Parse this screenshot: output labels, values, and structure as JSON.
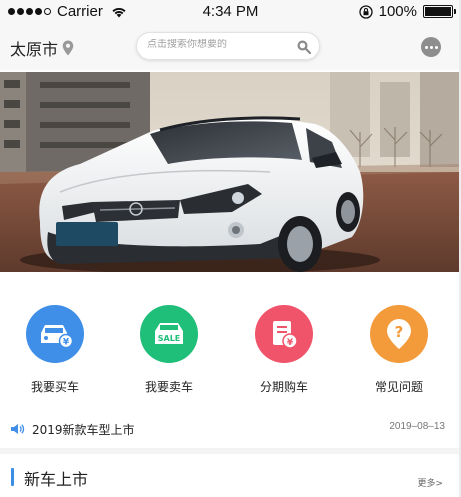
{
  "status_bar": {
    "carrier": "Carrier",
    "time": "4:34 PM",
    "battery_text": "100%",
    "battery_level": 1.0
  },
  "nav": {
    "city": "太原市",
    "search_placeholder": "点击搜索你想要的",
    "icons": [
      "location-icon",
      "search-icon",
      "more-icon"
    ]
  },
  "banner": {
    "icon": "car-photo"
  },
  "quick_menu": [
    {
      "label": "我要买车",
      "color": "#3f8fe8",
      "icon": "buy-car-icon"
    },
    {
      "label": "我要卖车",
      "color": "#1fbe79",
      "icon": "sale-car-icon",
      "badge": "SALE"
    },
    {
      "label": "分期购车",
      "color": "#f0546a",
      "icon": "installment-icon"
    },
    {
      "label": "常见问题",
      "color": "#f39a3a",
      "icon": "question-icon",
      "symbol": "?"
    }
  ],
  "news": {
    "title": "2019新款车型上市",
    "date": "2019–08–13"
  },
  "section": {
    "title": "新车上市",
    "more": "更多>"
  }
}
